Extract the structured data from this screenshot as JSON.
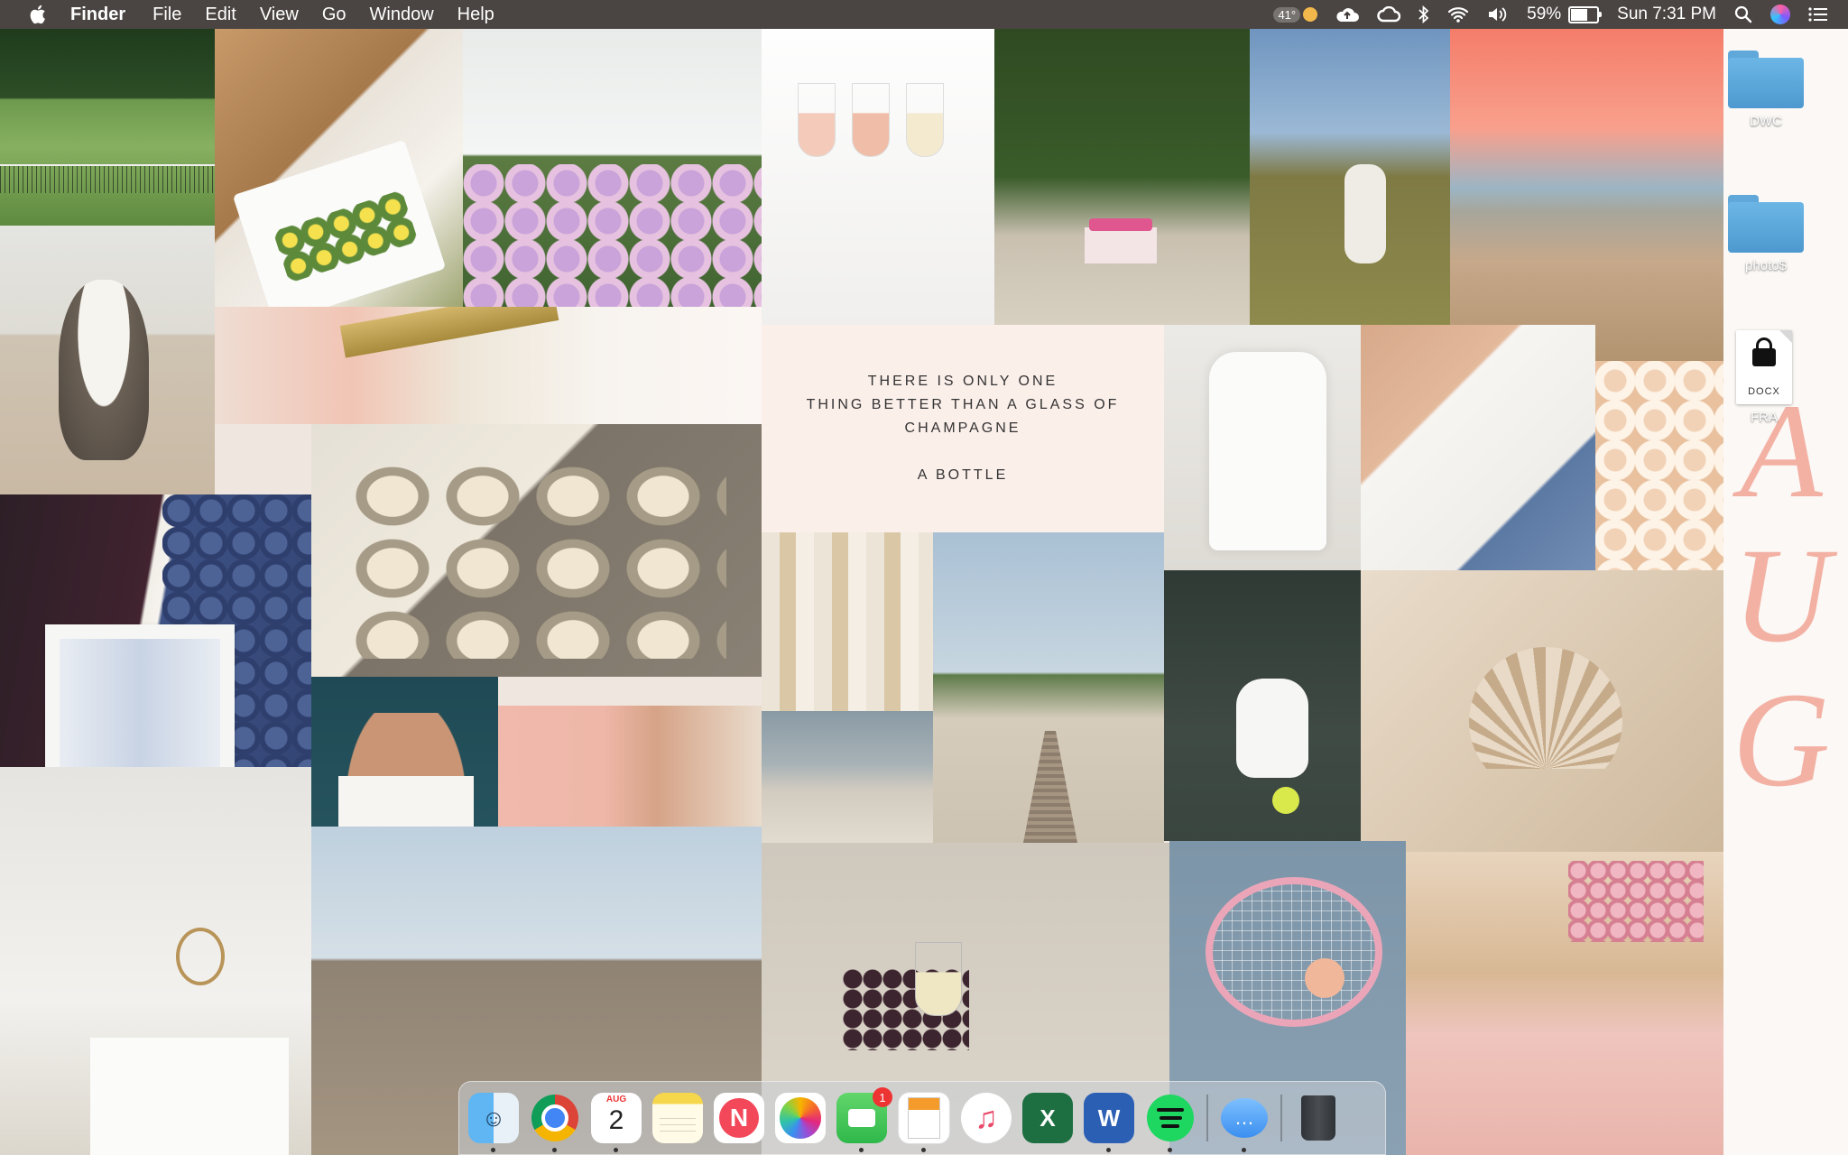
{
  "menubar": {
    "app_name": "Finder",
    "menus": [
      "File",
      "Edit",
      "View",
      "Go",
      "Window",
      "Help"
    ],
    "weather": "41°",
    "battery": "59%",
    "battery_level": 0.59,
    "clock": "Sun 7:31 PM"
  },
  "wallpaper": {
    "quote_lines": [
      "THERE IS ONLY ONE",
      "THING BETTER THAN A GLASS OF",
      "CHAMPAGNE"
    ],
    "quote_attribution": "A BOTTLE",
    "big_letters": [
      "A",
      "U",
      "G"
    ],
    "accent_color": "#f3b1a4"
  },
  "desktop_icons": [
    {
      "label": "DWC",
      "type": "folder"
    },
    {
      "label": "photo$",
      "type": "folder"
    },
    {
      "label": "FRA",
      "type": "document",
      "doc_type": "DOCX"
    }
  ],
  "dock": {
    "apps": [
      {
        "name": "Finder",
        "running": true
      },
      {
        "name": "Google Chrome",
        "running": true
      },
      {
        "name": "Calendar",
        "running": true,
        "month": "AUG",
        "day": "2"
      },
      {
        "name": "Notes",
        "running": false
      },
      {
        "name": "News",
        "running": false
      },
      {
        "name": "Photos",
        "running": false
      },
      {
        "name": "FaceTime",
        "running": true,
        "badge": "1"
      },
      {
        "name": "Pages",
        "running": true
      },
      {
        "name": "Music",
        "running": false
      },
      {
        "name": "Microsoft Excel",
        "running": false
      },
      {
        "name": "Microsoft Word",
        "running": true
      },
      {
        "name": "Spotify",
        "running": true
      },
      {
        "name": "Messages",
        "running": true
      },
      {
        "name": "Trash",
        "running": false
      }
    ]
  }
}
